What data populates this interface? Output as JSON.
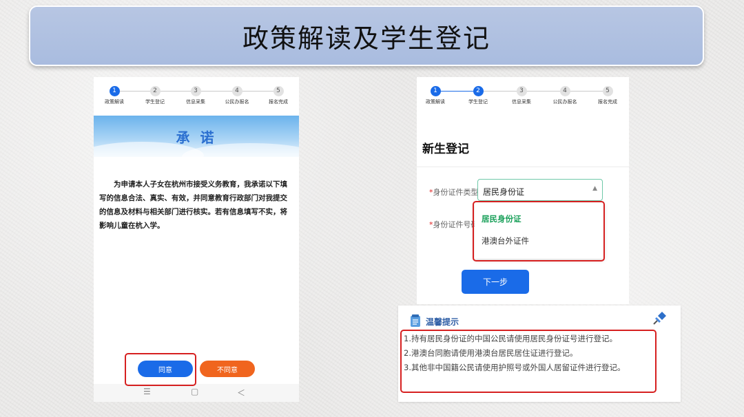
{
  "banner": {
    "title": "政策解读及学生登记"
  },
  "steps": [
    {
      "num": "1",
      "label": "政策解读"
    },
    {
      "num": "2",
      "label": "学生登记"
    },
    {
      "num": "3",
      "label": "信息采集"
    },
    {
      "num": "4",
      "label": "公民办报名"
    },
    {
      "num": "5",
      "label": "报名完成"
    }
  ],
  "left_screen": {
    "active_step": 1,
    "heading": "承 诺",
    "pledge": "为申请本人子女在杭州市接受义务教育，我承诺以下填写的信息合法、真实、有效，并同意教育行政部门对我提交的信息及材料与相关部门进行核实。若有信息填写不实，将影响儿童在杭入学。",
    "agree_button": "同意",
    "disagree_button": "不同意",
    "nav": {
      "menu_glyph": "☰",
      "home_glyph": "▢",
      "back_glyph": "＜"
    }
  },
  "right_screen": {
    "active_step": 2,
    "form_title": "新生登记",
    "id_type": {
      "required_mark": "*",
      "label": "身份证件类型",
      "value": "居民身份证",
      "arrow": "▲"
    },
    "id_number": {
      "required_mark": "*",
      "label": "身份证件号码"
    },
    "dropdown_options": [
      "居民身份证",
      "港澳台外证件"
    ],
    "next_button": "下一步"
  },
  "tips": {
    "title": "温馨提示",
    "items": [
      "1.持有居民身份证的中国公民请使用居民身份证号进行登记。",
      "2.港澳台同胞请使用港澳台居民居住证进行登记。",
      "3.其他非中国籍公民请使用护照号或外国人居留证件进行登记。"
    ]
  },
  "colors": {
    "primary": "#1a6be8",
    "danger_button": "#f0651e",
    "highlight_border": "#d61f1f",
    "banner": "#b7c6e3",
    "selected_option": "#1aa05a"
  }
}
